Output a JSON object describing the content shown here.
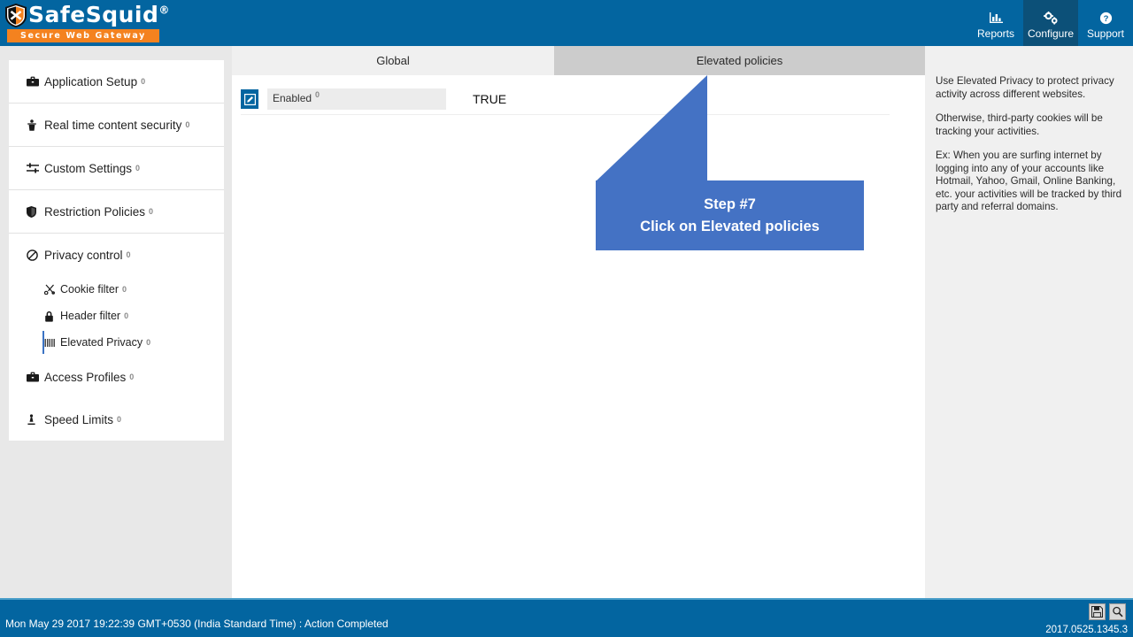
{
  "brand": {
    "name": "SafeSquid",
    "registered": "®",
    "tagline": "Secure Web Gateway"
  },
  "topnav": {
    "items": [
      {
        "label": "Reports",
        "icon": "chart-icon",
        "active": false
      },
      {
        "label": "Configure",
        "icon": "gears-icon",
        "active": true
      },
      {
        "label": "Support",
        "icon": "help-circle-icon",
        "active": false
      }
    ]
  },
  "sidebar": {
    "help_marker": "0",
    "items": [
      {
        "label": "Application Setup",
        "icon": "briefcase-icon"
      },
      {
        "label": "Real time content security",
        "icon": "shield-person-icon"
      },
      {
        "label": "Custom Settings",
        "icon": "sliders-icon"
      },
      {
        "label": "Restriction Policies",
        "icon": "shield-icon"
      },
      {
        "label": "Privacy control",
        "icon": "no-entry-icon"
      },
      {
        "label": "Cookie filter",
        "icon": "scissors-icon"
      },
      {
        "label": "Header filter",
        "icon": "lock-icon"
      },
      {
        "label": "Elevated Privacy",
        "icon": "bars-icon"
      },
      {
        "label": "Access Profiles",
        "icon": "briefcase-icon"
      },
      {
        "label": "Speed Limits",
        "icon": "gauge-icon"
      }
    ]
  },
  "main": {
    "tabs": [
      {
        "label": "Global",
        "selected": false
      },
      {
        "label": "Elevated policies",
        "selected": true
      }
    ],
    "rows": [
      {
        "label": "Enabled",
        "help_marker": "0",
        "value": "TRUE",
        "edit_icon": "edit-pencil-icon"
      }
    ]
  },
  "callout": {
    "line1": "Step #7",
    "line2": "Click on Elevated policies",
    "color": "#4472c4"
  },
  "help": {
    "paragraphs": [
      "Use Elevated Privacy to protect privacy activity across different websites.",
      "Otherwise, third-party cookies will be tracking your activities.",
      "Ex: When you are surfing internet by logging into any of your accounts like Hotmail, Yahoo, Gmail, Online Banking, etc. your activities will be tracked by third party and referral domains."
    ]
  },
  "statusbar": {
    "message": "Mon May 29 2017 19:22:39 GMT+0530 (India Standard Time) : Action Completed",
    "version": "2017.0525.1345.3",
    "icons": [
      {
        "name": "save-icon"
      },
      {
        "name": "search-icon"
      }
    ]
  },
  "colors": {
    "header_blue": "#0365a0",
    "active_nav": "#0c5078",
    "accent_orange": "#f4821f",
    "callout_blue": "#4472c4",
    "tab_selected": "#cccccc",
    "tab_unselected": "#f0f0f0"
  }
}
